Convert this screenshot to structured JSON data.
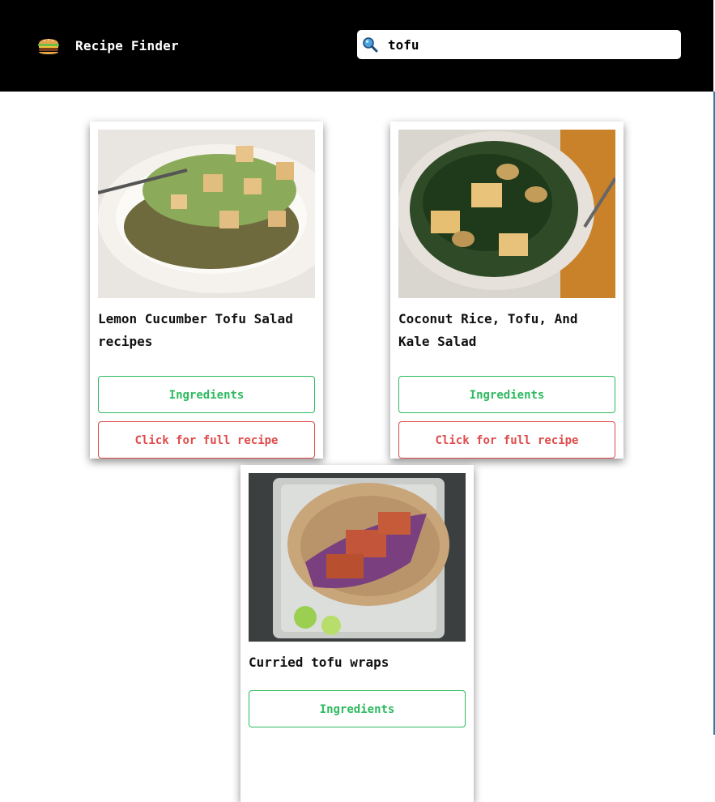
{
  "header": {
    "app_title": "Recipe Finder",
    "logo_icon": "hamburger-icon",
    "search_icon": "magnifier-icon",
    "search_value": "tofu"
  },
  "colors": {
    "header_bg": "#000000",
    "ingredients_green": "#2dba5f",
    "full_recipe_red": "#e04a4a"
  },
  "recipes": [
    {
      "title": "Lemon Cucumber Tofu Salad recipes",
      "image": "lentil-cucumber-tofu-salad-photo",
      "ingredients_label": "Ingredients",
      "full_recipe_label": "Click for full recipe"
    },
    {
      "title": "Coconut Rice, Tofu, And Kale Salad",
      "image": "kale-tofu-salad-bowl-photo",
      "ingredients_label": "Ingredients",
      "full_recipe_label": "Click for full recipe"
    },
    {
      "title": "Curried tofu wraps",
      "image": "curried-tofu-wrap-photo",
      "ingredients_label": "Ingredients"
    }
  ]
}
